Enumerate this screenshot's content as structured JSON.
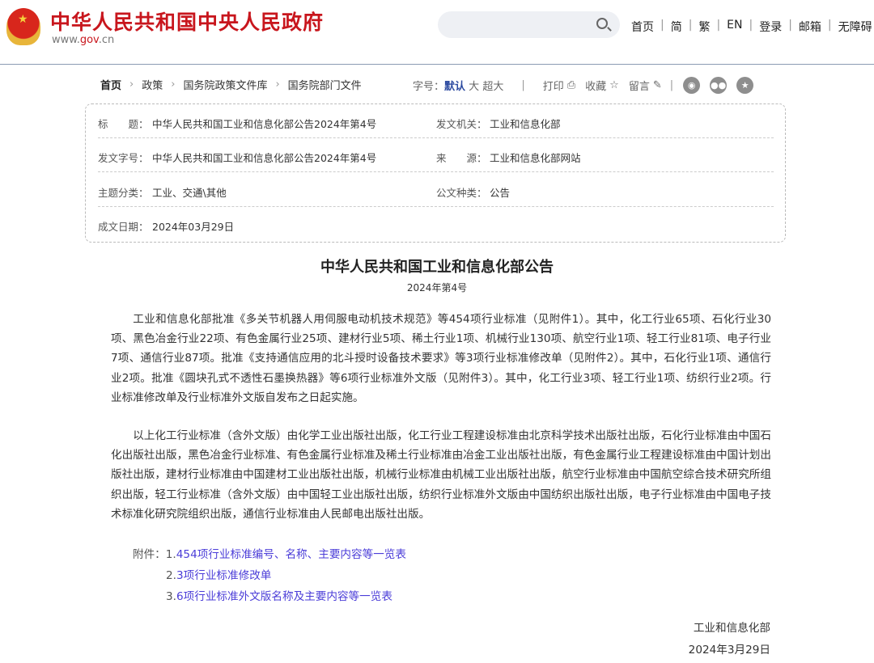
{
  "header": {
    "site_title": "中华人民共和国中央人民政府",
    "url_pre": "www.",
    "url_mid": "gov",
    "url_post": ".cn",
    "search_placeholder": "",
    "nav": [
      "首页",
      "简",
      "繁",
      "EN",
      "登录",
      "邮箱",
      "无障碍"
    ]
  },
  "breadcrumb": [
    "首页",
    "政策",
    "国务院政策文件库",
    "国务院部门文件"
  ],
  "tools": {
    "font_label": "字号：",
    "font_default": "默认",
    "font_large": "大",
    "font_xlarge": "超大",
    "print": "打印",
    "favorite": "收藏",
    "comment": "留言"
  },
  "info": {
    "title_label": "标　　题：",
    "title": "中华人民共和国工业和信息化部公告2024年第4号",
    "issuer_label": "发文机关：",
    "issuer": "工业和信息化部",
    "docno_label": "发文字号：",
    "docno": "中华人民共和国工业和信息化部公告2024年第4号",
    "source_label": "来　　源：",
    "source": "工业和信息化部网站",
    "topic_label": "主题分类：",
    "topic": "工业、交通\\其他",
    "type_label": "公文种类：",
    "type": "公告",
    "date_label": "成文日期：",
    "date": "2024年03月29日"
  },
  "doc": {
    "title": "中华人民共和国工业和信息化部公告",
    "subtitle": "2024年第4号",
    "p1": "工业和信息化部批准《多关节机器人用伺服电动机技术规范》等454项行业标准（见附件1）。其中，化工行业65项、石化行业30项、黑色冶金行业22项、有色金属行业25项、建材行业5项、稀土行业1项、机械行业130项、航空行业1项、轻工行业81项、电子行业7项、通信行业87项。批准《支持通信应用的北斗授时设备技术要求》等3项行业标准修改单（见附件2）。其中，石化行业1项、通信行业2项。批准《圆块孔式不透性石墨换热器》等6项行业标准外文版（见附件3）。其中，化工行业3项、轻工行业1项、纺织行业2项。行业标准修改单及行业标准外文版自发布之日起实施。",
    "p2": "以上化工行业标准（含外文版）由化学工业出版社出版，化工行业工程建设标准由北京科学技术出版社出版，石化行业标准由中国石化出版社出版，黑色冶金行业标准、有色金属行业标准及稀土行业标准由冶金工业出版社出版，有色金属行业工程建设标准由中国计划出版社出版，建材行业标准由中国建材工业出版社出版，机械行业标准由机械工业出版社出版，航空行业标准由中国航空综合技术研究所组织出版，轻工行业标准（含外文版）由中国轻工业出版社出版，纺织行业标准外文版由中国纺织出版社出版，电子行业标准由中国电子技术标准化研究院组织出版，通信行业标准由人民邮电出版社出版。",
    "att_label": "附件：",
    "attachments": [
      {
        "num": "1.",
        "text": "454项行业标准编号、名称、主要内容等一览表"
      },
      {
        "num": "2.",
        "text": "3项行业标准修改单"
      },
      {
        "num": "3.",
        "text": "6项行业标准外文版名称及主要内容等一览表"
      }
    ],
    "sign_org": "工业和信息化部",
    "sign_date": "2024年3月29日"
  },
  "colors": {
    "brand": "#c8161d",
    "link": "#4b3dd8",
    "accent": "#2c4aa0"
  }
}
